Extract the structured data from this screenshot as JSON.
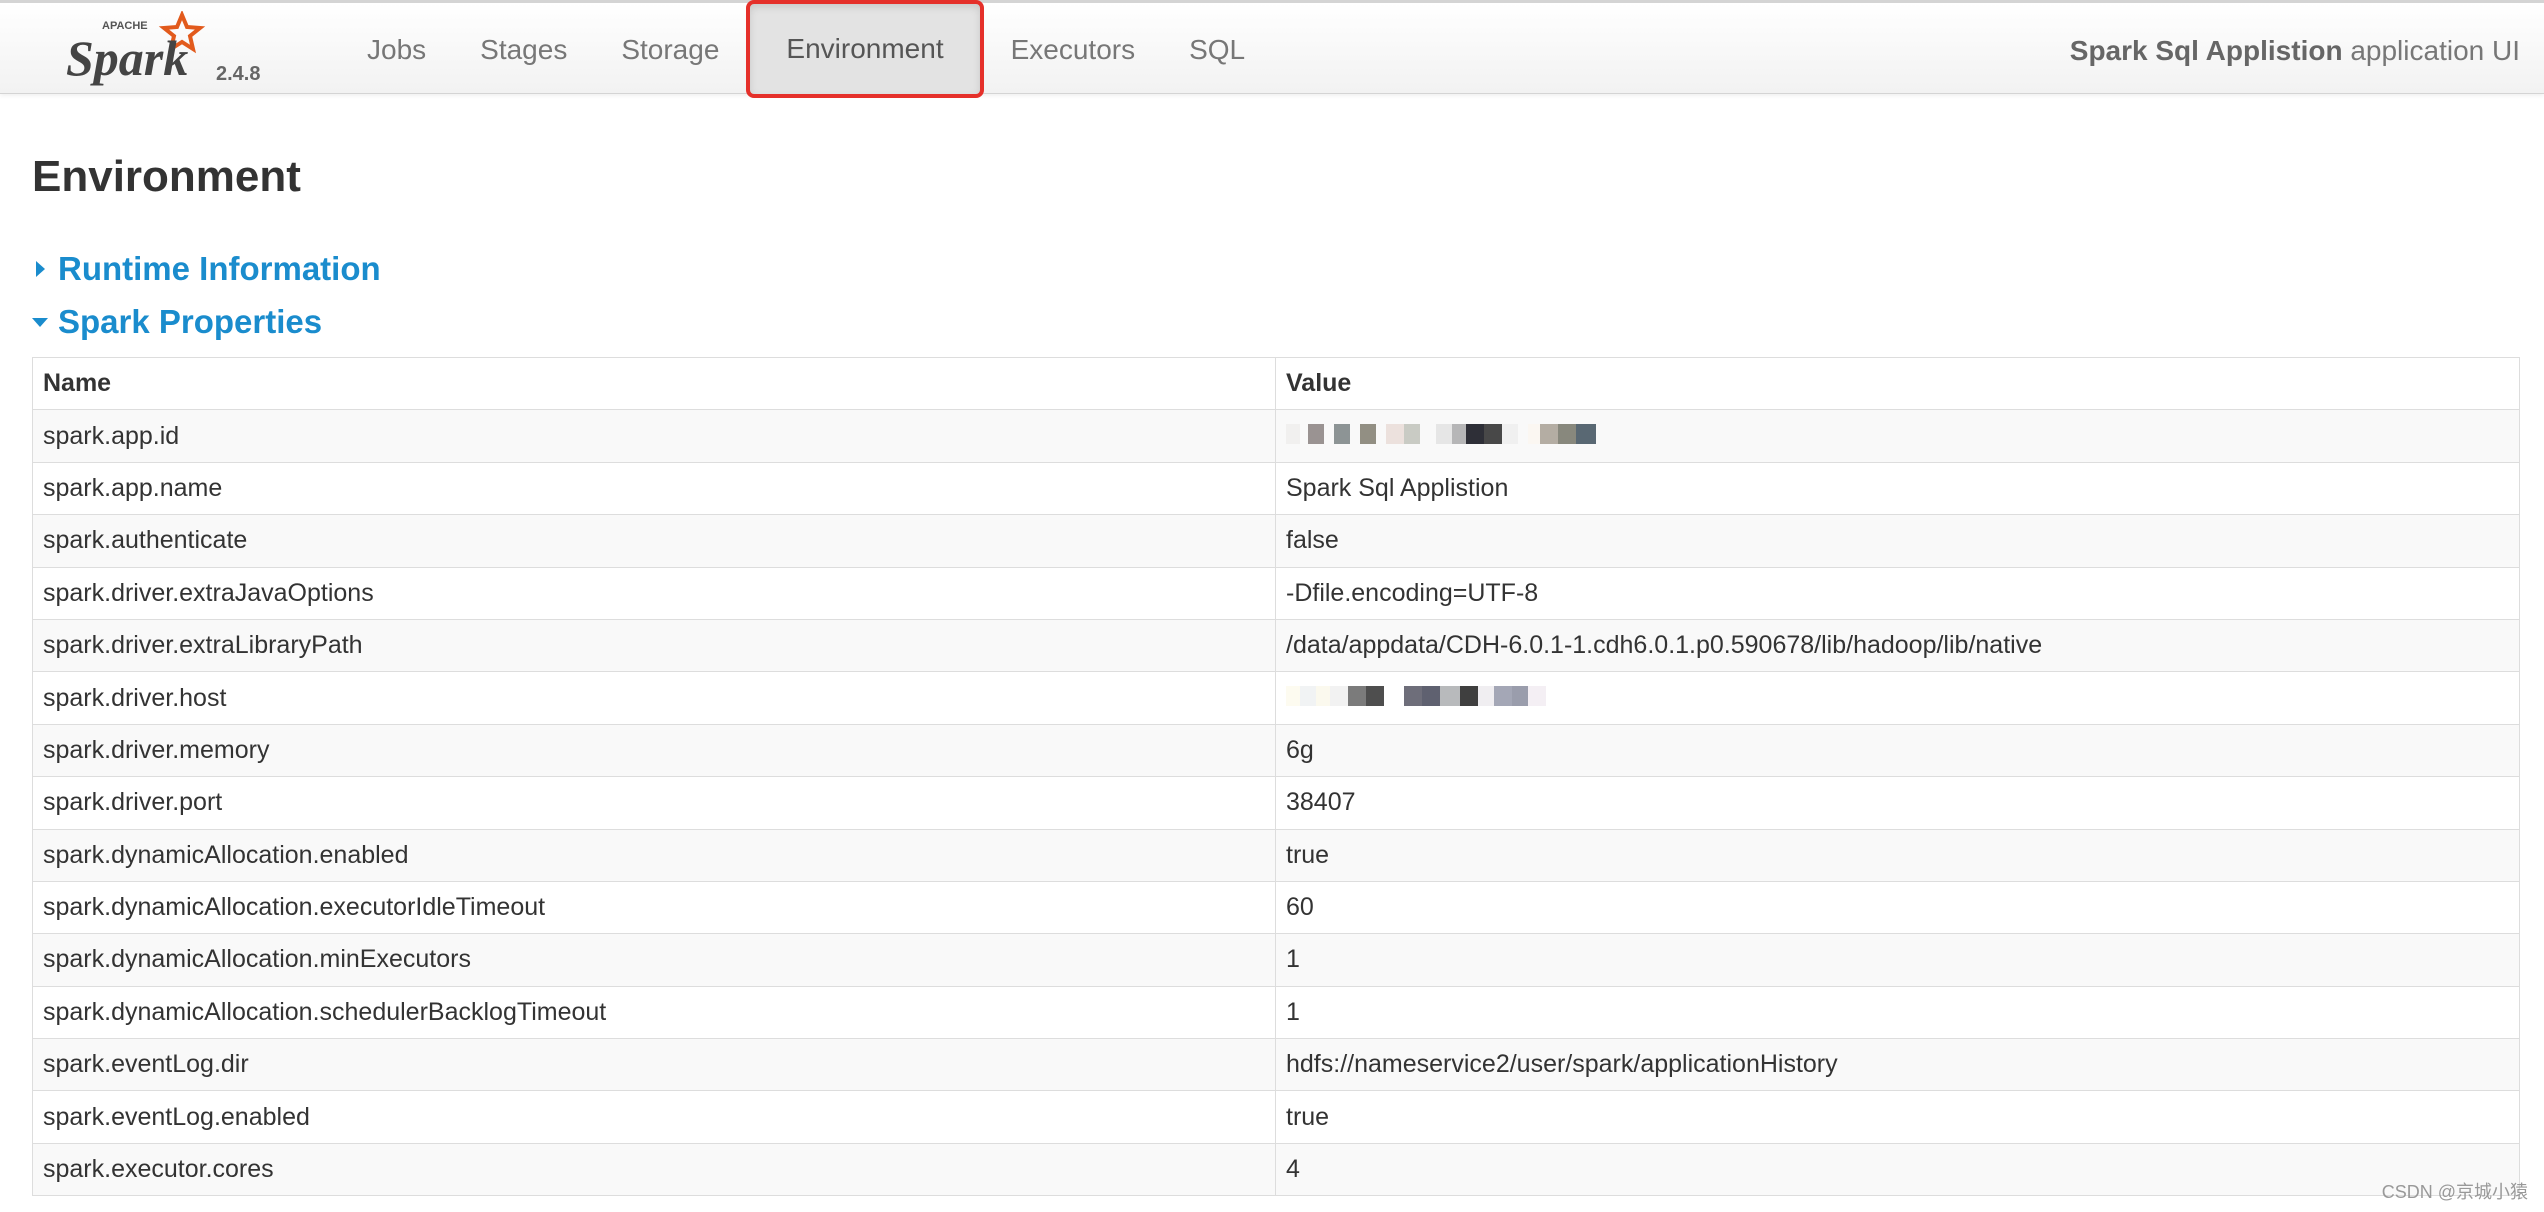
{
  "navbar": {
    "brand_small": "APACHE",
    "brand_name": "Spark",
    "version": "2.4.8",
    "items": [
      {
        "label": "Jobs",
        "active": false
      },
      {
        "label": "Stages",
        "active": false
      },
      {
        "label": "Storage",
        "active": false
      },
      {
        "label": "Environment",
        "active": true
      },
      {
        "label": "Executors",
        "active": false
      },
      {
        "label": "SQL",
        "active": false
      }
    ],
    "app_name": "Spark Sql Applistion",
    "app_suffix": " application UI"
  },
  "page": {
    "title": "Environment",
    "sections": [
      {
        "label": "Runtime Information",
        "expanded": false
      },
      {
        "label": "Spark Properties",
        "expanded": true
      }
    ]
  },
  "table": {
    "headers": {
      "name": "Name",
      "value": "Value"
    },
    "rows": [
      {
        "name": "spark.app.id",
        "value": ""
      },
      {
        "name": "spark.app.name",
        "value": "Spark Sql Applistion"
      },
      {
        "name": "spark.authenticate",
        "value": "false"
      },
      {
        "name": "spark.driver.extraJavaOptions",
        "value": "-Dfile.encoding=UTF-8"
      },
      {
        "name": "spark.driver.extraLibraryPath",
        "value": "/data/appdata/CDH-6.0.1-1.cdh6.0.1.p0.590678/lib/hadoop/lib/native"
      },
      {
        "name": "spark.driver.host",
        "value": ""
      },
      {
        "name": "spark.driver.memory",
        "value": "6g"
      },
      {
        "name": "spark.driver.port",
        "value": "38407"
      },
      {
        "name": "spark.dynamicAllocation.enabled",
        "value": "true"
      },
      {
        "name": "spark.dynamicAllocation.executorIdleTimeout",
        "value": "60"
      },
      {
        "name": "spark.dynamicAllocation.minExecutors",
        "value": "1"
      },
      {
        "name": "spark.dynamicAllocation.schedulerBacklogTimeout",
        "value": "1"
      },
      {
        "name": "spark.eventLog.dir",
        "value": "hdfs://nameservice2/user/spark/applicationHistory"
      },
      {
        "name": "spark.eventLog.enabled",
        "value": "true"
      },
      {
        "name": "spark.executor.cores",
        "value": "4"
      }
    ]
  },
  "watermark": "CSDN @京城小猿",
  "colors": {
    "link": "#1a8ccd",
    "active_highlight": "#e5302a",
    "spark_orange": "#e25a1c"
  }
}
